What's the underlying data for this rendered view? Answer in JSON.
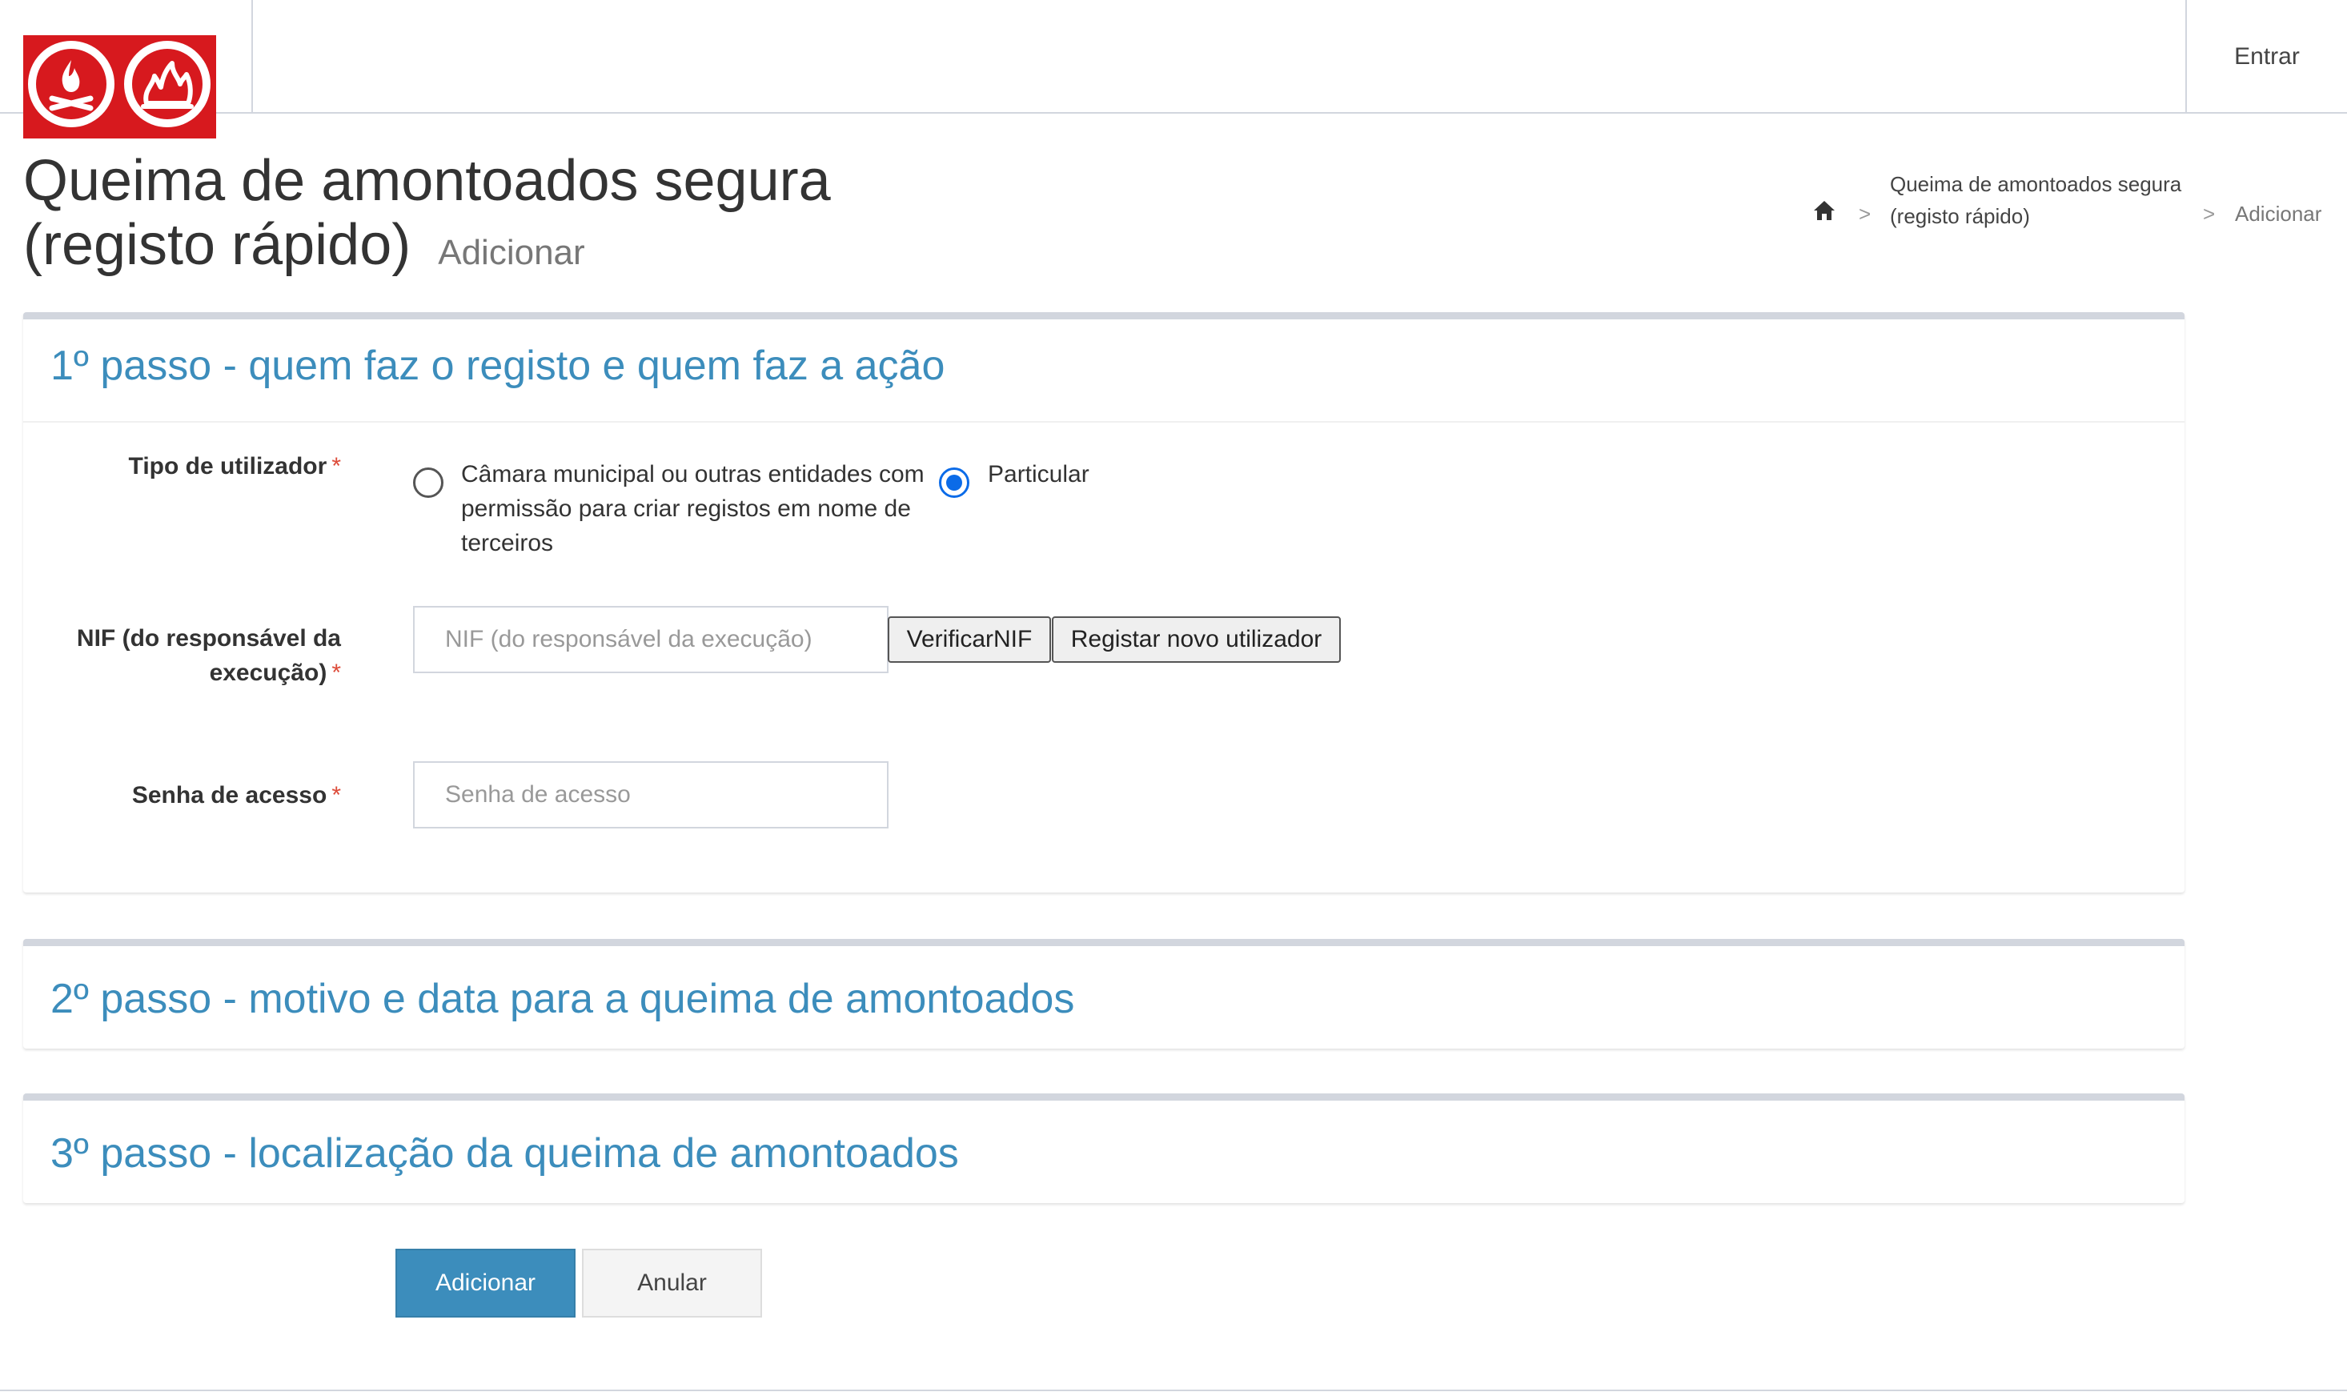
{
  "header": {
    "login_label": "Entrar",
    "brand_color": "#d7191e"
  },
  "page": {
    "title": "Queima de amontoados segura (registo rápido)",
    "subtitle": "Adicionar"
  },
  "breadcrumb": {
    "home_icon": "home-icon",
    "items": [
      "Queima de amontoados segura (registo rápido)",
      "Adicionar"
    ],
    "separator": ">"
  },
  "steps": [
    {
      "title": "1º passo - quem faz o registo e quem faz a ação"
    },
    {
      "title": "2º passo - motivo e data para a queima de amontoados"
    },
    {
      "title": "3º passo - localização da queima de amontoados"
    }
  ],
  "form": {
    "required_mark": "*",
    "tipo_utilizador": {
      "label": "Tipo de utilizador",
      "options": [
        {
          "label": "Câmara municipal ou outras entidades com permissão para criar registos em nome de terceiros",
          "checked": false
        },
        {
          "label": "Particular",
          "checked": true
        }
      ]
    },
    "nif": {
      "label": "NIF (do responsável da execução)",
      "placeholder": "NIF (do responsável da execução)",
      "value": ""
    },
    "verificar_label": "VerificarNIF",
    "registar_label": "Registar novo utilizador",
    "senha": {
      "label": "Senha de acesso",
      "placeholder": "Senha de acesso",
      "value": ""
    }
  },
  "actions": {
    "add_label": "Adicionar",
    "cancel_label": "Anular",
    "primary_color": "#3c8dbc"
  }
}
